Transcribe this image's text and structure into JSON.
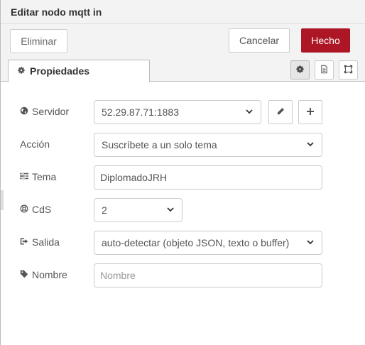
{
  "header": {
    "title": "Editar nodo mqtt in"
  },
  "toolbar": {
    "delete_label": "Eliminar",
    "cancel_label": "Cancelar",
    "done_label": "Hecho",
    "done_color": "#ad1625"
  },
  "tabs": {
    "active": {
      "label": "Propiedades",
      "icon": "gear-icon"
    },
    "icon_buttons": [
      "gear-icon",
      "document-icon",
      "frame-icon"
    ]
  },
  "form": {
    "server": {
      "label": "Servidor",
      "icon": "globe-icon",
      "value": "52.29.87.71:1883"
    },
    "action": {
      "label": "Acción",
      "value": "Suscríbete a un solo tema"
    },
    "topic": {
      "label": "Tema",
      "icon": "tasks-icon",
      "value": "DiplomadoJRH"
    },
    "qos": {
      "label": "CdS",
      "icon": "life-ring-icon",
      "value": "2"
    },
    "output": {
      "label": "Salida",
      "icon": "sign-out-icon",
      "value": "auto-detectar (objeto JSON, texto o buffer)"
    },
    "name": {
      "label": "Nombre",
      "icon": "tag-icon",
      "value": "",
      "placeholder": "Nombre"
    }
  }
}
